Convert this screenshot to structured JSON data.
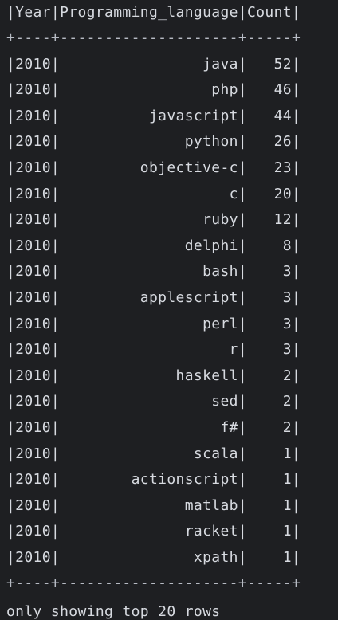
{
  "table": {
    "header": "|Year|Programming_language|Count|",
    "separator": "+----+--------------------+-----+",
    "rows": [
      "|2010|                java|   52|",
      "|2010|                 php|   46|",
      "|2010|          javascript|   44|",
      "|2010|              python|   26|",
      "|2010|         objective-c|   23|",
      "|2010|                   c|   20|",
      "|2010|                ruby|   12|",
      "|2010|              delphi|    8|",
      "|2010|                bash|    3|",
      "|2010|         applescript|    3|",
      "|2010|                perl|    3|",
      "|2010|                   r|    3|",
      "|2010|             haskell|    2|",
      "|2010|                 sed|    2|",
      "|2010|                  f#|    2|",
      "|2010|               scala|    1|",
      "|2010|        actionscript|    1|",
      "|2010|              matlab|    1|",
      "|2010|              racket|    1|",
      "|2010|               xpath|    1|"
    ],
    "footer": "only showing top 20 rows"
  }
}
